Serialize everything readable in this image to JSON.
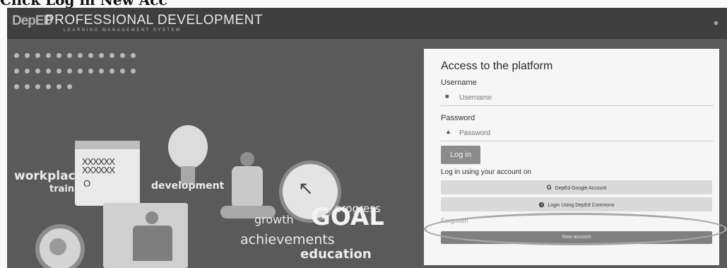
{
  "caption": "Click Log in New Acc",
  "header": {
    "logo": "DepED",
    "title": "PROFESSIONAL DEVELOPMENT",
    "subtitle": "LEARNING MANAGEMENT SYSTEM",
    "menu_icon": "settings-icon"
  },
  "hero": {
    "words": {
      "workplace": "workplace",
      "training": "training",
      "development": "development",
      "progress": "progress",
      "growth": "growth",
      "goal": "GOAL",
      "achievements": "achievements",
      "education": "education"
    },
    "calendar_rows": "XXXXXX\nXXXXXX",
    "calendar_mark": "O"
  },
  "login": {
    "title": "Access to the platform",
    "username_label": "Username",
    "username_placeholder": "Username",
    "password_label": "Password",
    "password_placeholder": "Password",
    "login_button": "Log in",
    "using_text": "Log in using your account on",
    "google_button": "DepEd Google Account",
    "deped_button": "Login Using DepEd Commons",
    "forgotten_text": "Forgotten",
    "new_account_button": "New account"
  }
}
